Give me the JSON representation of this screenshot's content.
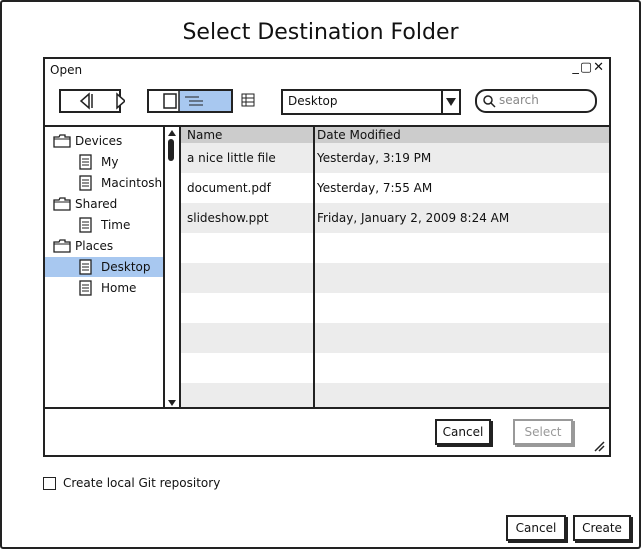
{
  "dialog": {
    "title": "Select Destination Folder"
  },
  "window": {
    "title": "Open",
    "controls": "_▢✕",
    "path_value": "Desktop",
    "search_placeholder": "search"
  },
  "sidebar": {
    "items": [
      {
        "label": "Devices",
        "type": "folder"
      },
      {
        "label": "My",
        "type": "file"
      },
      {
        "label": "Macintosh",
        "type": "file"
      },
      {
        "label": "Shared",
        "type": "folder"
      },
      {
        "label": "Time",
        "type": "file"
      },
      {
        "label": "Places",
        "type": "folder"
      },
      {
        "label": "Desktop",
        "type": "file",
        "selected": true
      },
      {
        "label": "Home",
        "type": "file"
      }
    ]
  },
  "files": {
    "headers": {
      "name": "Name",
      "date": "Date Modified"
    },
    "rows": [
      {
        "name": "a nice little file",
        "date": "Yesterday, 3:19 PM"
      },
      {
        "name": "document.pdf",
        "date": "Yesterday, 7:55 AM"
      },
      {
        "name": "slideshow.ppt",
        "date": "Friday, January 2, 2009 8:24 AM"
      }
    ]
  },
  "window_buttons": {
    "cancel": "Cancel",
    "select": "Select"
  },
  "options": {
    "git_repo_label": "Create local Git repository",
    "git_repo_checked": false
  },
  "actions": {
    "cancel": "Cancel",
    "create": "Create"
  }
}
